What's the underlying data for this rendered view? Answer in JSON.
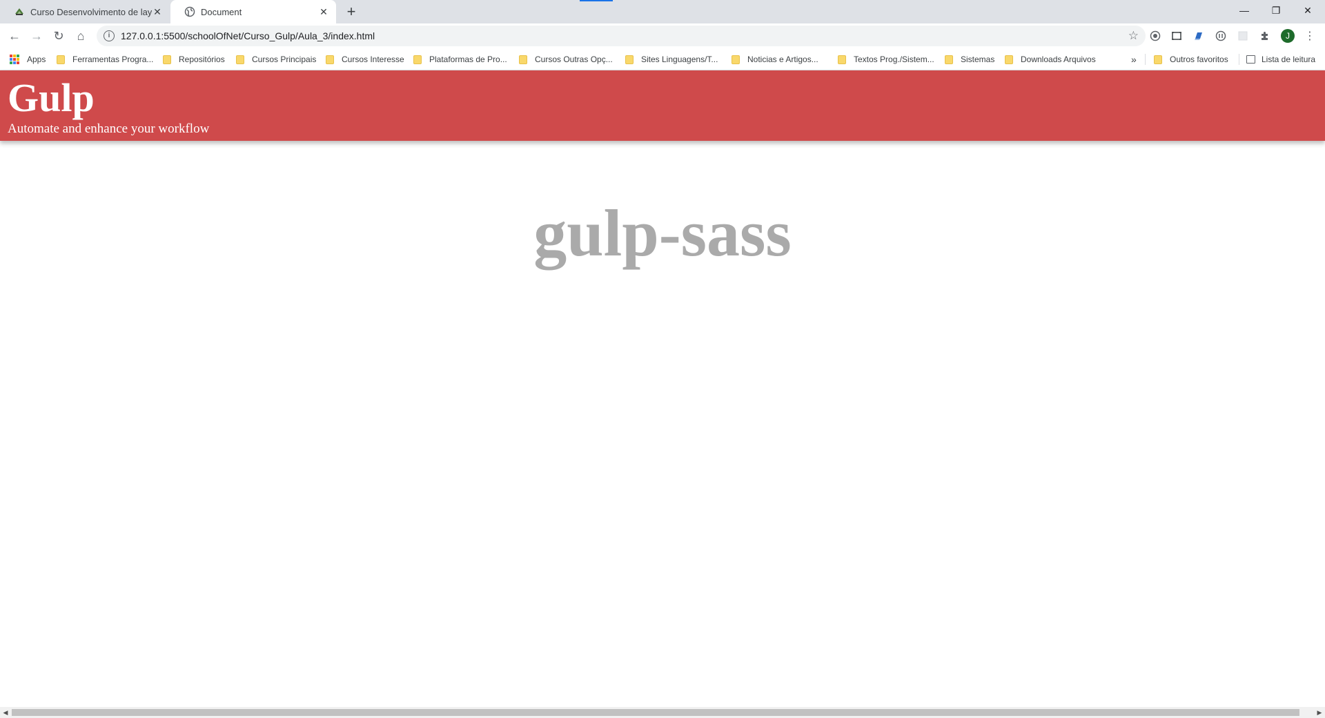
{
  "browser": {
    "tabs": [
      {
        "title": "Curso Desenvolvimento de layou",
        "active": false,
        "favicon": "school-of-net-favicon"
      },
      {
        "title": "Document",
        "active": true,
        "favicon": "globe-icon"
      }
    ],
    "new_tab_label": "+",
    "window_controls": {
      "minimize": "—",
      "restore": "❐",
      "close": "✕"
    },
    "address": {
      "url": "127.0.0.1:5500/schoolOfNet/Curso_Gulp/Aula_3/index.html",
      "info_icon": "i",
      "bookmark_star": "☆"
    },
    "nav": {
      "back": "←",
      "forward": "→",
      "reload": "↻",
      "home": "⌂"
    },
    "extensions": [
      "extension-1-icon",
      "screenshot-icon",
      "extension-3-icon",
      "extension-4-icon",
      "extension-5-icon",
      "puzzle-icon"
    ],
    "profile_initial": "J",
    "menu_glyph": "⋮",
    "bookmarks": [
      {
        "label": "Apps",
        "type": "apps"
      },
      {
        "label": "Ferramentas Progra...",
        "type": "folder"
      },
      {
        "label": "Repositórios",
        "type": "folder"
      },
      {
        "label": "Cursos Principais",
        "type": "folder"
      },
      {
        "label": "Cursos Interesse",
        "type": "folder"
      },
      {
        "label": "Plataformas de Pro...",
        "type": "folder"
      },
      {
        "label": "Cursos Outras Opç...",
        "type": "folder"
      },
      {
        "label": "Sites Linguagens/T...",
        "type": "folder"
      },
      {
        "label": "Noticias e Artigos...",
        "type": "folder"
      },
      {
        "label": "Textos Prog./Sistem...",
        "type": "folder"
      },
      {
        "label": "Sistemas",
        "type": "folder"
      },
      {
        "label": "Downloads Arquivos",
        "type": "folder"
      }
    ],
    "overflow_chevron": "»",
    "other_favorites": "Outros favoritos",
    "reading_list": "Lista de leitura"
  },
  "page": {
    "header": {
      "title": "Gulp",
      "tagline": "Automate and enhance your workflow",
      "background_color": "#cf4a4b"
    },
    "heading": "gulp-sass",
    "heading_color": "#aaaaaa"
  },
  "scrollbar": {
    "left_arrow": "◀",
    "right_arrow": "▶"
  }
}
